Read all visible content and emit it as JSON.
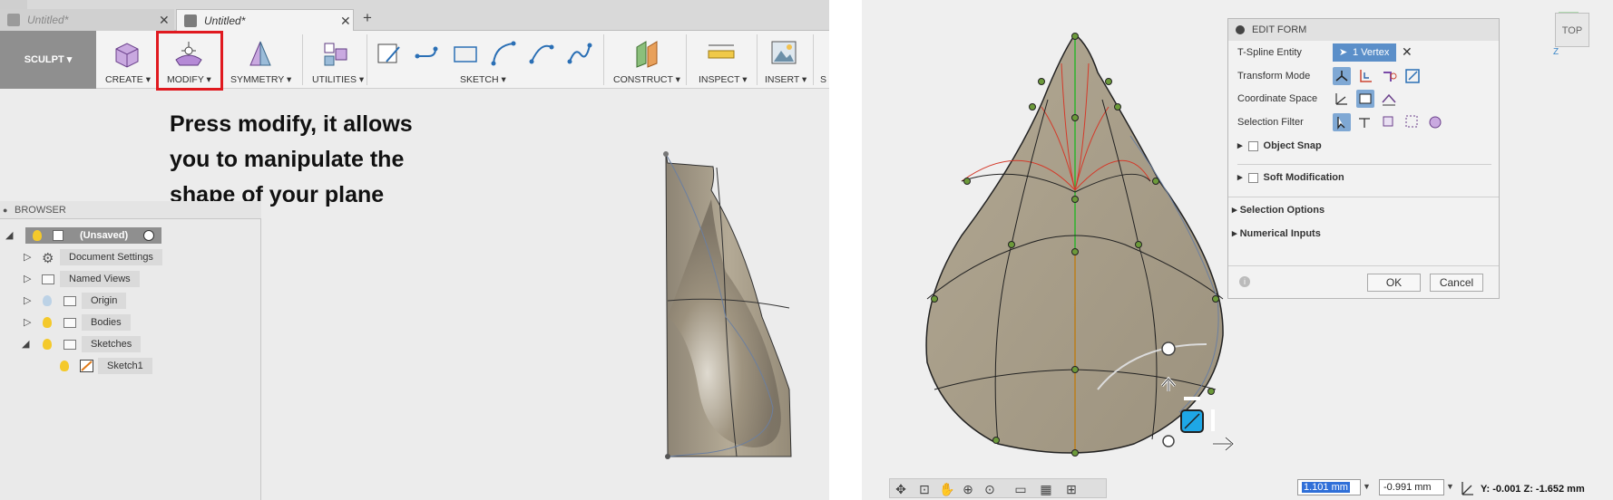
{
  "left_panel": {
    "tabs": [
      {
        "label": "Untitled*",
        "close": "✕"
      },
      {
        "label": "Untitled*",
        "close": "✕"
      }
    ],
    "new_tab": "+",
    "workspace": "SCULPT ▾",
    "toolbar_groups": [
      {
        "label": "CREATE ▾"
      },
      {
        "label": "MODIFY ▾"
      },
      {
        "label": "SYMMETRY ▾"
      },
      {
        "label": "UTILITIES ▾"
      },
      {
        "label": "SKETCH ▾"
      },
      {
        "label": "CONSTRUCT ▾"
      },
      {
        "label": "INSPECT ▾"
      },
      {
        "label": "INSERT ▾"
      },
      {
        "label": "S"
      }
    ],
    "instruction_lines": [
      "Press modify, it allows",
      "you to manipulate the",
      "shape of your plane"
    ],
    "browser": {
      "title": "BROWSER",
      "root": "(Unsaved)",
      "items": [
        {
          "label": "Document Settings"
        },
        {
          "label": "Named Views"
        },
        {
          "label": "Origin"
        },
        {
          "label": "Bodies"
        },
        {
          "label": "Sketches"
        },
        {
          "label": "Sketch1"
        }
      ]
    }
  },
  "edit_form": {
    "title": "EDIT FORM",
    "rows": {
      "tspline_entity": "T-Spline Entity",
      "entity_value": "1 Vertex",
      "transform_mode": "Transform Mode",
      "coordinate_space": "Coordinate Space",
      "selection_filter": "Selection Filter"
    },
    "sections": {
      "object_snap": "Object Snap",
      "soft_mod": "Soft Modification",
      "selection_options": "Selection Options",
      "numerical_inputs": "Numerical Inputs"
    },
    "ok_label": "OK",
    "cancel_label": "Cancel"
  },
  "view": {
    "viewcube_label": "TOP",
    "axis_z": "Z",
    "numeric_1": "1.101 mm",
    "numeric_2": "-0.991 mm",
    "coords": "Y: -0.001 Z: -1.652 mm"
  },
  "colors": {
    "highlight_red": "#e0191f",
    "selection_blue": "#5b8fc9",
    "shape_fill": "#a59a85"
  }
}
